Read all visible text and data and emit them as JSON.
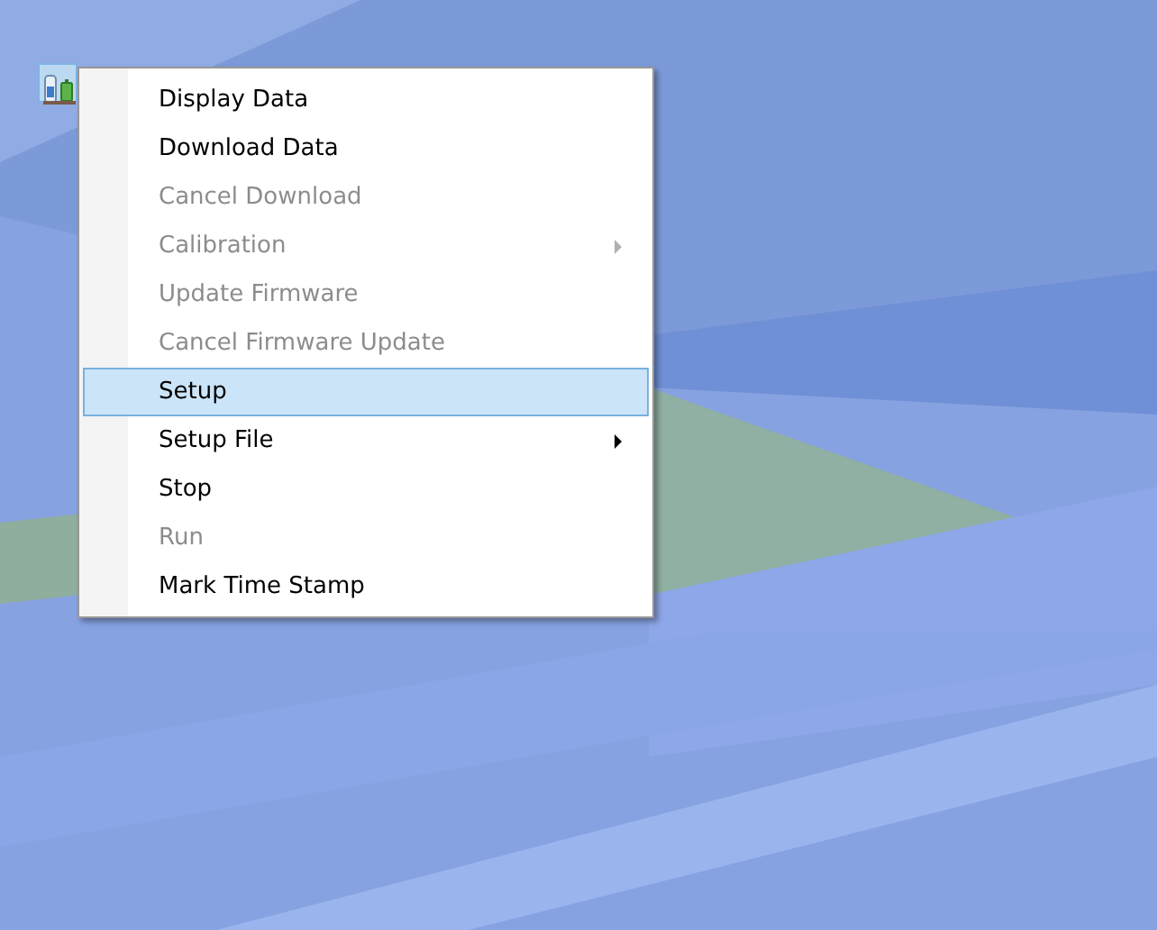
{
  "desktop_icon": {
    "selected": true
  },
  "context_menu": {
    "items": [
      {
        "label": "Display Data",
        "disabled": false,
        "selected": false,
        "submenu": false
      },
      {
        "label": "Download Data",
        "disabled": false,
        "selected": false,
        "submenu": false
      },
      {
        "label": "Cancel Download",
        "disabled": true,
        "selected": false,
        "submenu": false
      },
      {
        "label": "Calibration",
        "disabled": true,
        "selected": false,
        "submenu": true
      },
      {
        "label": "Update Firmware",
        "disabled": true,
        "selected": false,
        "submenu": false
      },
      {
        "label": "Cancel Firmware Update",
        "disabled": true,
        "selected": false,
        "submenu": false
      },
      {
        "label": "Setup",
        "disabled": false,
        "selected": true,
        "submenu": false
      },
      {
        "label": "Setup File",
        "disabled": false,
        "selected": false,
        "submenu": true
      },
      {
        "label": "Stop",
        "disabled": false,
        "selected": false,
        "submenu": false
      },
      {
        "label": "Run",
        "disabled": true,
        "selected": false,
        "submenu": false
      },
      {
        "label": "Mark Time Stamp",
        "disabled": false,
        "selected": false,
        "submenu": false
      }
    ]
  }
}
